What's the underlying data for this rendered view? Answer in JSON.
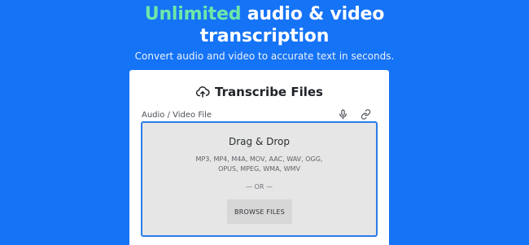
{
  "hero": {
    "title_accent": "Unlimited",
    "title_rest_line1": " audio & video",
    "title_line2": "transcription",
    "subtitle": "Convert audio and video to accurate text in seconds."
  },
  "card": {
    "title": "Transcribe Files",
    "header_icon": "upload-cloud-icon",
    "field_label": "Audio / Video File",
    "field_icons": [
      "microphone-icon",
      "link-icon"
    ],
    "dropzone": {
      "title": "Drag & Drop",
      "formats_line1": "MP3, MP4, M4A, MOV, AAC, WAV, OGG,",
      "formats_line2": "OPUS, MPEG, WMA, WMV",
      "separator": "— OR —",
      "browse_label": "BROWSE FILES"
    }
  },
  "colors": {
    "background": "#1573f6",
    "accent": "#6ee7a8",
    "dropzone_border": "#2b7de9",
    "dropzone_fill": "#e6e6e6"
  }
}
